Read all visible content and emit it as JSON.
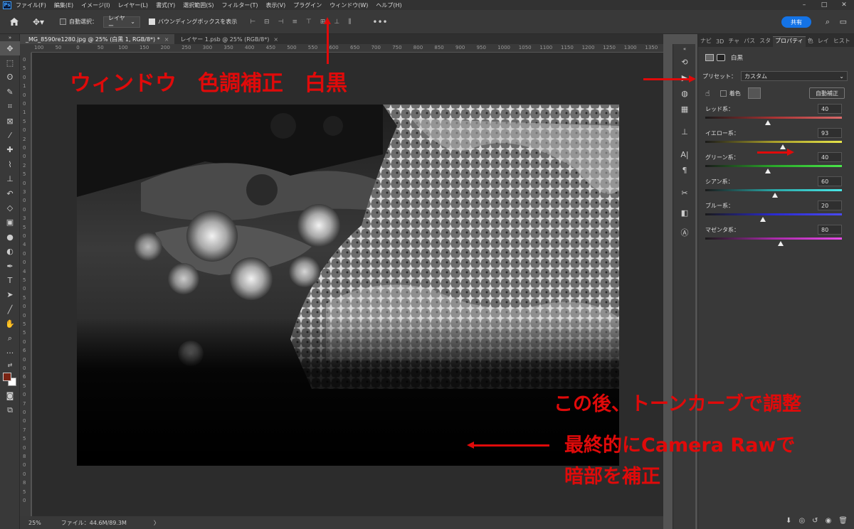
{
  "menubar": {
    "logo": "Ps",
    "items": [
      "ファイル(F)",
      "編集(E)",
      "イメージ(I)",
      "レイヤー(L)",
      "書式(Y)",
      "選択範囲(S)",
      "フィルター(T)",
      "表示(V)",
      "プラグイン",
      "ウィンドウ(W)",
      "ヘルプ(H)"
    ],
    "window_controls": [
      "–",
      "□",
      "✕"
    ]
  },
  "optionsbar": {
    "auto_select_label": "自動選択：",
    "auto_select_value": "レイヤー",
    "bounding_box_label": "バウンディングボックスを表示",
    "more": "•••",
    "share_label": "共有"
  },
  "tabs": [
    {
      "label": "_MG_8590re1280.jpg @ 25% (白黒 1, RGB/8*) *",
      "close": "×"
    },
    {
      "label": "レイヤー 1.psb @ 25% (RGB/8*)",
      "close": "×"
    }
  ],
  "ruler": {
    "h_ticks": [
      "100",
      "50",
      "0",
      "50",
      "100",
      "150",
      "200",
      "250",
      "300",
      "350",
      "400",
      "450",
      "500",
      "550",
      "600",
      "650",
      "700",
      "750",
      "800",
      "850",
      "900",
      "950",
      "1000",
      "1050",
      "1100",
      "1150",
      "1200",
      "1250",
      "1300",
      "1350"
    ],
    "v_ticks": [
      "0",
      "5",
      "0",
      "1",
      "0",
      "0",
      "1",
      "5",
      "0",
      "2",
      "0",
      "0",
      "2",
      "5",
      "0",
      "3",
      "0",
      "0",
      "3",
      "5",
      "0",
      "4",
      "0",
      "0",
      "4",
      "5",
      "0",
      "5",
      "0",
      "0",
      "5",
      "5",
      "0",
      "6",
      "0",
      "0",
      "6",
      "5",
      "0",
      "7",
      "0",
      "0",
      "7",
      "5",
      "0",
      "8",
      "0",
      "0",
      "8",
      "5",
      "0"
    ]
  },
  "status": {
    "zoom": "25%",
    "file": "ファイル：44.6M/89.3M",
    "chevron": "〉"
  },
  "panel": {
    "tabs": [
      "ナビ",
      "3D",
      "チャ",
      "パス",
      "スタ",
      "プロパティ",
      "色",
      "レイ",
      "ヒスト"
    ],
    "title": "白黒",
    "preset_label": "プリセット：",
    "preset_value": "カスタム",
    "tint_label": "着色",
    "auto_label": "自動補正",
    "sliders": [
      {
        "label": "レッド系：",
        "value": "40",
        "pct": 0.46,
        "gradient": "linear-gradient(90deg,#1a1a1a,#a83232,#d96a6a)"
      },
      {
        "label": "イエロー系：",
        "value": "93",
        "pct": 0.57,
        "gradient": "linear-gradient(90deg,#1a1a1a,#a89e2a,#e6e44a)"
      },
      {
        "label": "グリーン系：",
        "value": "40",
        "pct": 0.46,
        "gradient": "linear-gradient(90deg,#1a1a1a,#2aa82a,#4ae64a)"
      },
      {
        "label": "シアン系：",
        "value": "60",
        "pct": 0.51,
        "gradient": "linear-gradient(90deg,#1a1a1a,#2aa8a8,#4ae6e6)"
      },
      {
        "label": "ブルー系：",
        "value": "20",
        "pct": 0.42,
        "gradient": "linear-gradient(90deg,#1a1a1a,#2a2ad0,#4a4af0)"
      },
      {
        "label": "マゼンタ系：",
        "value": "80",
        "pct": 0.55,
        "gradient": "linear-gradient(90deg,#1a1a1a,#a82aa8,#e64ae6)"
      }
    ]
  },
  "annotations": {
    "menu_path": "ウィンドウ　色調補正　白黒",
    "tone_curve": "この後、トーンカーブで調整",
    "camera_raw_1": "最終的にCamera Rawで",
    "camera_raw_2": "暗部を補正"
  },
  "colors": {
    "accent_blue": "#1473e6",
    "annotation_red": "#e00a0a",
    "fg_swatch": "#7a2414",
    "bg_swatch": "#ffffff"
  }
}
